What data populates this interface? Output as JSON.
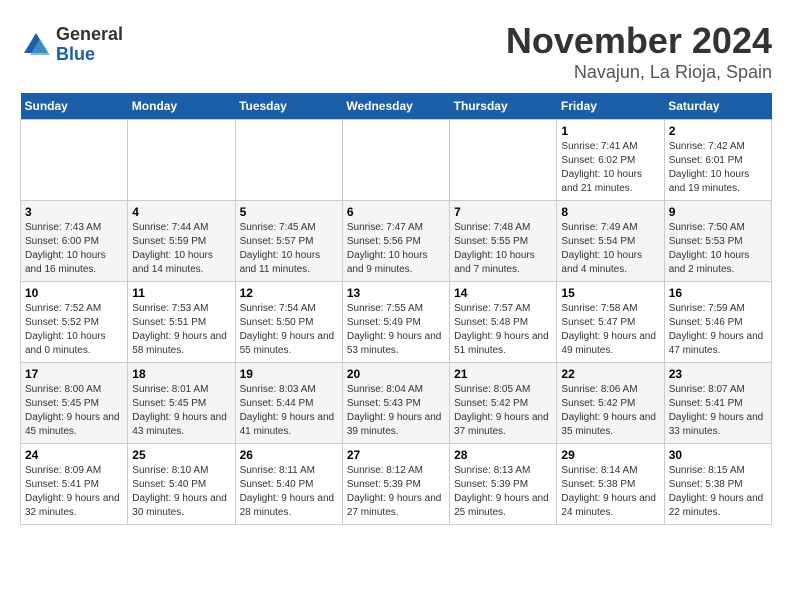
{
  "logo": {
    "general": "General",
    "blue": "Blue"
  },
  "title": "November 2024",
  "location": "Navajun, La Rioja, Spain",
  "header_days": [
    "Sunday",
    "Monday",
    "Tuesday",
    "Wednesday",
    "Thursday",
    "Friday",
    "Saturday"
  ],
  "weeks": [
    [
      {
        "day": "",
        "info": ""
      },
      {
        "day": "",
        "info": ""
      },
      {
        "day": "",
        "info": ""
      },
      {
        "day": "",
        "info": ""
      },
      {
        "day": "",
        "info": ""
      },
      {
        "day": "1",
        "info": "Sunrise: 7:41 AM\nSunset: 6:02 PM\nDaylight: 10 hours and 21 minutes."
      },
      {
        "day": "2",
        "info": "Sunrise: 7:42 AM\nSunset: 6:01 PM\nDaylight: 10 hours and 19 minutes."
      }
    ],
    [
      {
        "day": "3",
        "info": "Sunrise: 7:43 AM\nSunset: 6:00 PM\nDaylight: 10 hours and 16 minutes."
      },
      {
        "day": "4",
        "info": "Sunrise: 7:44 AM\nSunset: 5:59 PM\nDaylight: 10 hours and 14 minutes."
      },
      {
        "day": "5",
        "info": "Sunrise: 7:45 AM\nSunset: 5:57 PM\nDaylight: 10 hours and 11 minutes."
      },
      {
        "day": "6",
        "info": "Sunrise: 7:47 AM\nSunset: 5:56 PM\nDaylight: 10 hours and 9 minutes."
      },
      {
        "day": "7",
        "info": "Sunrise: 7:48 AM\nSunset: 5:55 PM\nDaylight: 10 hours and 7 minutes."
      },
      {
        "day": "8",
        "info": "Sunrise: 7:49 AM\nSunset: 5:54 PM\nDaylight: 10 hours and 4 minutes."
      },
      {
        "day": "9",
        "info": "Sunrise: 7:50 AM\nSunset: 5:53 PM\nDaylight: 10 hours and 2 minutes."
      }
    ],
    [
      {
        "day": "10",
        "info": "Sunrise: 7:52 AM\nSunset: 5:52 PM\nDaylight: 10 hours and 0 minutes."
      },
      {
        "day": "11",
        "info": "Sunrise: 7:53 AM\nSunset: 5:51 PM\nDaylight: 9 hours and 58 minutes."
      },
      {
        "day": "12",
        "info": "Sunrise: 7:54 AM\nSunset: 5:50 PM\nDaylight: 9 hours and 55 minutes."
      },
      {
        "day": "13",
        "info": "Sunrise: 7:55 AM\nSunset: 5:49 PM\nDaylight: 9 hours and 53 minutes."
      },
      {
        "day": "14",
        "info": "Sunrise: 7:57 AM\nSunset: 5:48 PM\nDaylight: 9 hours and 51 minutes."
      },
      {
        "day": "15",
        "info": "Sunrise: 7:58 AM\nSunset: 5:47 PM\nDaylight: 9 hours and 49 minutes."
      },
      {
        "day": "16",
        "info": "Sunrise: 7:59 AM\nSunset: 5:46 PM\nDaylight: 9 hours and 47 minutes."
      }
    ],
    [
      {
        "day": "17",
        "info": "Sunrise: 8:00 AM\nSunset: 5:45 PM\nDaylight: 9 hours and 45 minutes."
      },
      {
        "day": "18",
        "info": "Sunrise: 8:01 AM\nSunset: 5:45 PM\nDaylight: 9 hours and 43 minutes."
      },
      {
        "day": "19",
        "info": "Sunrise: 8:03 AM\nSunset: 5:44 PM\nDaylight: 9 hours and 41 minutes."
      },
      {
        "day": "20",
        "info": "Sunrise: 8:04 AM\nSunset: 5:43 PM\nDaylight: 9 hours and 39 minutes."
      },
      {
        "day": "21",
        "info": "Sunrise: 8:05 AM\nSunset: 5:42 PM\nDaylight: 9 hours and 37 minutes."
      },
      {
        "day": "22",
        "info": "Sunrise: 8:06 AM\nSunset: 5:42 PM\nDaylight: 9 hours and 35 minutes."
      },
      {
        "day": "23",
        "info": "Sunrise: 8:07 AM\nSunset: 5:41 PM\nDaylight: 9 hours and 33 minutes."
      }
    ],
    [
      {
        "day": "24",
        "info": "Sunrise: 8:09 AM\nSunset: 5:41 PM\nDaylight: 9 hours and 32 minutes."
      },
      {
        "day": "25",
        "info": "Sunrise: 8:10 AM\nSunset: 5:40 PM\nDaylight: 9 hours and 30 minutes."
      },
      {
        "day": "26",
        "info": "Sunrise: 8:11 AM\nSunset: 5:40 PM\nDaylight: 9 hours and 28 minutes."
      },
      {
        "day": "27",
        "info": "Sunrise: 8:12 AM\nSunset: 5:39 PM\nDaylight: 9 hours and 27 minutes."
      },
      {
        "day": "28",
        "info": "Sunrise: 8:13 AM\nSunset: 5:39 PM\nDaylight: 9 hours and 25 minutes."
      },
      {
        "day": "29",
        "info": "Sunrise: 8:14 AM\nSunset: 5:38 PM\nDaylight: 9 hours and 24 minutes."
      },
      {
        "day": "30",
        "info": "Sunrise: 8:15 AM\nSunset: 5:38 PM\nDaylight: 9 hours and 22 minutes."
      }
    ]
  ]
}
